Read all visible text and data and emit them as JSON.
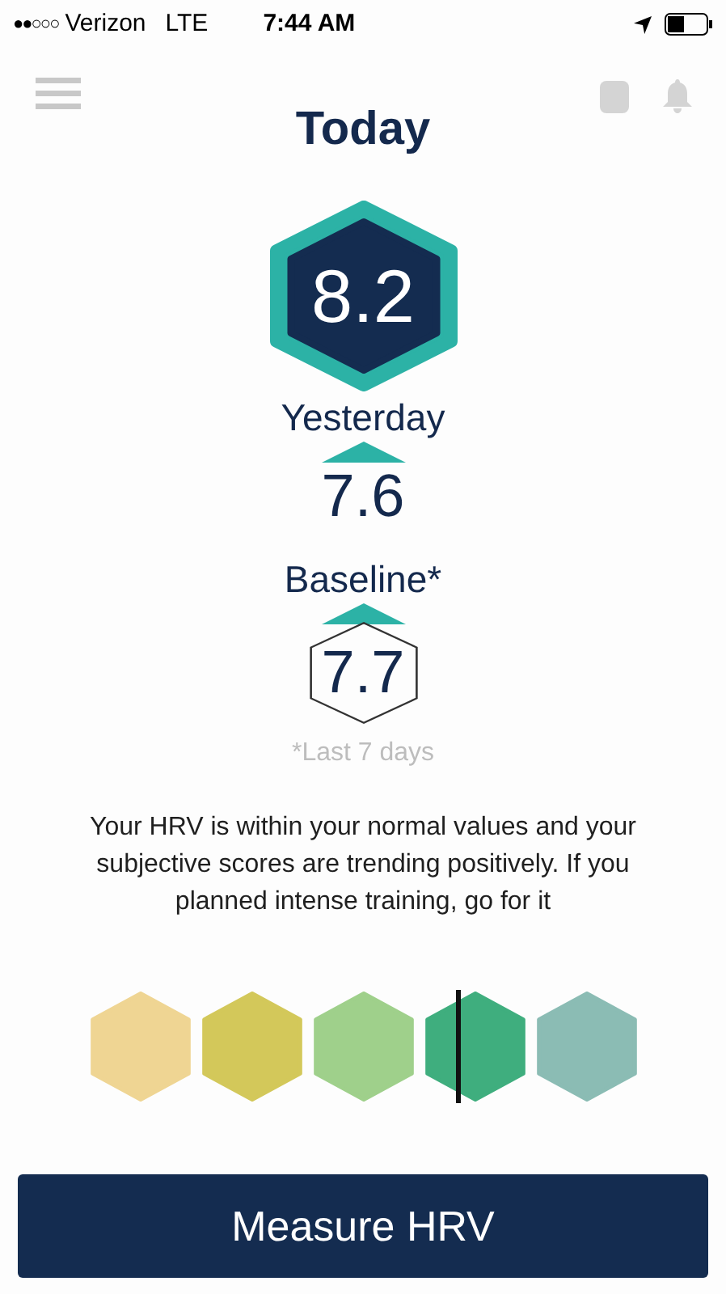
{
  "status_bar": {
    "signal": "●●○○○",
    "carrier": "Verizon",
    "network": "LTE",
    "time": "7:44 AM"
  },
  "title": "Today",
  "today": {
    "value": "8.2"
  },
  "yesterday": {
    "label": "Yesterday",
    "value": "7.6",
    "rising": true
  },
  "baseline": {
    "label": "Baseline*",
    "value": "7.7",
    "rising": true,
    "note": "*Last 7 days"
  },
  "message": "Your HRV is within your normal values and your subjective scores are trending positively. If you planned intense training, go for it",
  "scale": {
    "segments": [
      {
        "color": "#efd593",
        "selected": false
      },
      {
        "color": "#d3c85a",
        "selected": false
      },
      {
        "color": "#9fd08b",
        "selected": false
      },
      {
        "color": "#3fae7e",
        "selected": true
      },
      {
        "color": "#8bbcb4",
        "selected": false
      }
    ]
  },
  "button": "Measure HRV"
}
